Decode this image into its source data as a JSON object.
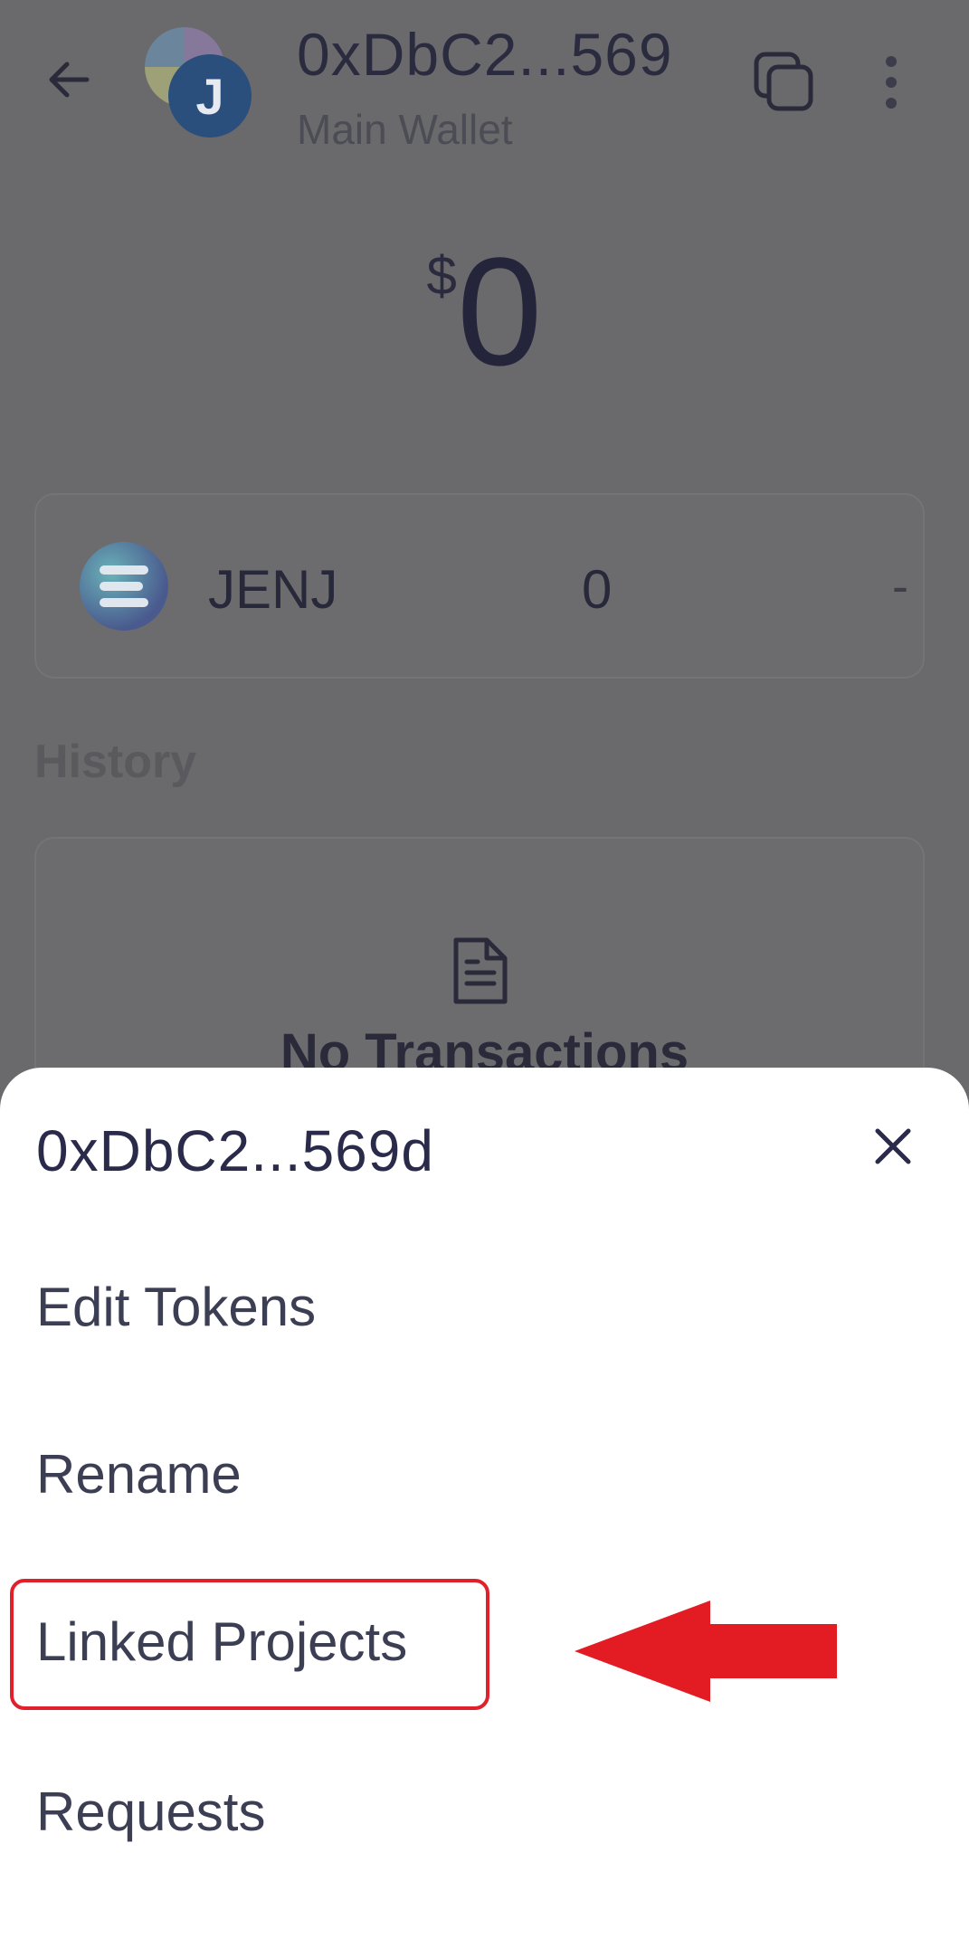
{
  "header": {
    "avatar_letter": "J",
    "wallet_address": "0xDbC2...569",
    "wallet_name": "Main Wallet"
  },
  "balance": {
    "currency_symbol": "$",
    "amount": "0"
  },
  "tokens": [
    {
      "symbol": "JENJ",
      "balance": "0",
      "fiat_value": "-"
    }
  ],
  "history": {
    "title": "History",
    "empty_text": "No Transactions"
  },
  "sheet": {
    "title": "0xDbC2...569d",
    "items": [
      {
        "label": "Edit Tokens"
      },
      {
        "label": "Rename"
      },
      {
        "label": "Linked Projects"
      },
      {
        "label": "Requests"
      }
    ]
  },
  "colors": {
    "overlay_background": "#6a6a6d",
    "sheet_background": "#ffffff",
    "highlight": "#e0202a"
  },
  "icons": [
    "back-arrow-icon",
    "copy-icon",
    "more-vertical-icon",
    "document-icon",
    "close-icon",
    "pointer-arrow-icon"
  ]
}
